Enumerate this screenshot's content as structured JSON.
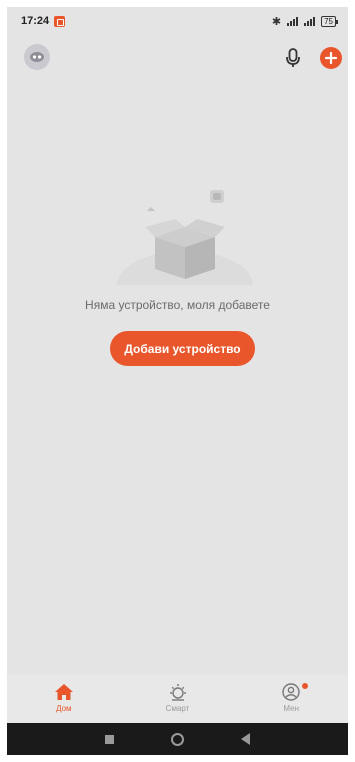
{
  "status_bar": {
    "time": "17:24",
    "battery": "75"
  },
  "header": {
    "avatar_icon": "user-avatar-icon",
    "mic_icon": "microphone-icon",
    "add_icon": "plus-icon"
  },
  "empty_state": {
    "message": "Няма устройство, моля добавете",
    "button_label": "Добави устройство"
  },
  "bottom_nav": {
    "items": [
      {
        "label": "Дом",
        "icon": "home-icon",
        "active": true
      },
      {
        "label": "Смарт",
        "icon": "sun-icon",
        "active": false
      },
      {
        "label": "Мен",
        "icon": "profile-icon",
        "active": false
      }
    ]
  },
  "colors": {
    "accent": "#e9562b",
    "background": "#e4e4e4"
  }
}
